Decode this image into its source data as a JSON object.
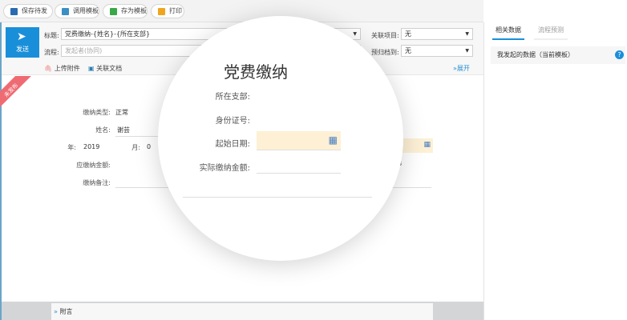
{
  "toolbar": {
    "buttons": [
      {
        "label": "保存待发",
        "icon": "save-icon",
        "color": "#2a6bb0"
      },
      {
        "label": "调用模板",
        "icon": "template-icon",
        "color": "#3a8fc4"
      },
      {
        "label": "存为模板",
        "icon": "save-template-icon",
        "color": "#3aa848"
      },
      {
        "label": "打印",
        "icon": "print-icon",
        "color": "#f0a51e"
      }
    ]
  },
  "header": {
    "send_label": "发送",
    "title_label": "标题:",
    "title_value": "党费缴纳-{姓名}-{所在支部}",
    "flow_label": "流程:",
    "flow_placeholder": "发起者(协同)",
    "project_label": "关联项目:",
    "project_value": "无",
    "archive_label": "预归档到:",
    "archive_value": "无",
    "upload_label": "上传附件",
    "related_doc_label": "关联文档",
    "expand_label": "展开"
  },
  "ribbon": "未发布",
  "form": {
    "type_label": "缴纳类型:",
    "type_value": "正常",
    "name_label": "姓名:",
    "name_value": "谢芸",
    "year_label": "年:",
    "year_value": "2019",
    "month_label": "月:",
    "month_value": "0",
    "due_label": "应缴纳金额:",
    "remark_label": "缴纳备注:",
    "date_partial": "4-03"
  },
  "magnifier": {
    "title": "党费缴纳",
    "branch_label": "所在支部:",
    "id_label": "身份证号:",
    "start_label": "起始日期:",
    "actual_label": "实际缴纳金额:"
  },
  "right_panel": {
    "tabs": [
      "相关数据",
      "流程预测"
    ],
    "active_tab": "相关数据",
    "item": "我发起的数据（当前模板）"
  },
  "footer": {
    "label": "附言"
  },
  "colors": {
    "accent": "#1a8fd9",
    "date_field": "#fdf0d5"
  }
}
